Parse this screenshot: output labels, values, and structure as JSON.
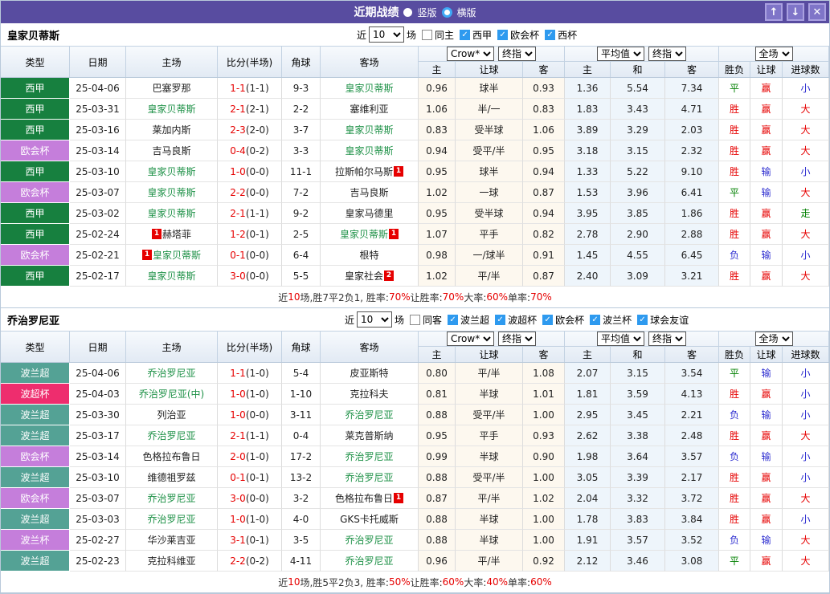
{
  "titlebar": {
    "title": "近期战绩",
    "vertical_label": "竖版",
    "horizontal_label": "横版",
    "bar_color": "#584CA0"
  },
  "window_buttons": {
    "up": "↑",
    "down": "↓",
    "close": "✕"
  },
  "filter": {
    "near_label": "近",
    "count": "10",
    "games_label": "场"
  },
  "headers": {
    "left": [
      "类型",
      "日期",
      "主场",
      "比分(半场)",
      "角球",
      "客场"
    ],
    "sub": [
      "主",
      "让球",
      "客",
      "主",
      "和",
      "客",
      "胜负",
      "让球",
      "进球数"
    ]
  },
  "dropdowns": {
    "odds_company": "Crow*",
    "final_odds": "终指",
    "average": "平均值",
    "final_odds2": "终指",
    "period": "全场"
  },
  "colors": {
    "focus_team": "#1E9147",
    "score": "#E60000",
    "type": {
      "西甲": "#17803F",
      "欧会杯": "#C57EDB",
      "波兰超": "#54A295",
      "波超杯": "#EE2D6E",
      "波兰杯": "#C57EDB"
    },
    "verdict": {
      "胜": "#E60000",
      "平": "#008000",
      "负": "#2A2ACF",
      "赢": "#E60000",
      "输": "#2A2ACF",
      "走": "#008000",
      "大": "#E60000",
      "小": "#2A2ACF"
    }
  },
  "tables": [
    {
      "team": "皇家贝蒂斯",
      "same_label": "同主",
      "leagues": [
        "西甲",
        "欧会杯",
        "西杯"
      ],
      "rows": [
        {
          "type": "西甲",
          "date": "25-04-06",
          "home": "巴塞罗那",
          "hf": false,
          "hb": "",
          "score": "1-1",
          "half": "(1-1)",
          "corner": "9-3",
          "away": "皇家贝蒂斯",
          "af": true,
          "ab": "",
          "ah": [
            "0.96",
            "球半",
            "0.93"
          ],
          "eu": [
            "1.36",
            "5.54",
            "7.34"
          ],
          "v": [
            "平",
            "赢",
            "小"
          ]
        },
        {
          "type": "西甲",
          "date": "25-03-31",
          "home": "皇家贝蒂斯",
          "hf": true,
          "hb": "",
          "score": "2-1",
          "half": "(2-1)",
          "corner": "2-2",
          "away": "塞维利亚",
          "af": false,
          "ab": "",
          "ah": [
            "1.06",
            "半/一",
            "0.83"
          ],
          "eu": [
            "1.83",
            "3.43",
            "4.71"
          ],
          "v": [
            "胜",
            "赢",
            "大"
          ]
        },
        {
          "type": "西甲",
          "date": "25-03-16",
          "home": "莱加内斯",
          "hf": false,
          "hb": "",
          "score": "2-3",
          "half": "(2-0)",
          "corner": "3-7",
          "away": "皇家贝蒂斯",
          "af": true,
          "ab": "",
          "ah": [
            "0.83",
            "受半球",
            "1.06"
          ],
          "eu": [
            "3.89",
            "3.29",
            "2.03"
          ],
          "v": [
            "胜",
            "赢",
            "大"
          ]
        },
        {
          "type": "欧会杯",
          "date": "25-03-14",
          "home": "吉马良斯",
          "hf": false,
          "hb": "",
          "score": "0-4",
          "half": "(0-2)",
          "corner": "3-3",
          "away": "皇家贝蒂斯",
          "af": true,
          "ab": "",
          "ah": [
            "0.94",
            "受平/半",
            "0.95"
          ],
          "eu": [
            "3.18",
            "3.15",
            "2.32"
          ],
          "v": [
            "胜",
            "赢",
            "大"
          ]
        },
        {
          "type": "西甲",
          "date": "25-03-10",
          "home": "皇家贝蒂斯",
          "hf": true,
          "hb": "",
          "score": "1-0",
          "half": "(0-0)",
          "corner": "11-1",
          "away": "拉斯帕尔马斯",
          "af": false,
          "ab": "1",
          "ah": [
            "0.95",
            "球半",
            "0.94"
          ],
          "eu": [
            "1.33",
            "5.22",
            "9.10"
          ],
          "v": [
            "胜",
            "输",
            "小"
          ]
        },
        {
          "type": "欧会杯",
          "date": "25-03-07",
          "home": "皇家贝蒂斯",
          "hf": true,
          "hb": "",
          "score": "2-2",
          "half": "(0-0)",
          "corner": "7-2",
          "away": "吉马良斯",
          "af": false,
          "ab": "",
          "ah": [
            "1.02",
            "一球",
            "0.87"
          ],
          "eu": [
            "1.53",
            "3.96",
            "6.41"
          ],
          "v": [
            "平",
            "输",
            "大"
          ]
        },
        {
          "type": "西甲",
          "date": "25-03-02",
          "home": "皇家贝蒂斯",
          "hf": true,
          "hb": "",
          "score": "2-1",
          "half": "(1-1)",
          "corner": "9-2",
          "away": "皇家马德里",
          "af": false,
          "ab": "",
          "ah": [
            "0.95",
            "受半球",
            "0.94"
          ],
          "eu": [
            "3.95",
            "3.85",
            "1.86"
          ],
          "v": [
            "胜",
            "赢",
            "走"
          ]
        },
        {
          "type": "西甲",
          "date": "25-02-24",
          "home": "赫塔菲",
          "hf": false,
          "hb": "1",
          "score": "1-2",
          "half": "(0-1)",
          "corner": "2-5",
          "away": "皇家贝蒂斯",
          "af": true,
          "ab": "1",
          "ah": [
            "1.07",
            "平手",
            "0.82"
          ],
          "eu": [
            "2.78",
            "2.90",
            "2.88"
          ],
          "v": [
            "胜",
            "赢",
            "大"
          ]
        },
        {
          "type": "欧会杯",
          "date": "25-02-21",
          "home": "皇家贝蒂斯",
          "hf": true,
          "hb": "1",
          "score": "0-1",
          "half": "(0-0)",
          "corner": "6-4",
          "away": "根特",
          "af": false,
          "ab": "",
          "ah": [
            "0.98",
            "一/球半",
            "0.91"
          ],
          "eu": [
            "1.45",
            "4.55",
            "6.45"
          ],
          "v": [
            "负",
            "输",
            "小"
          ]
        },
        {
          "type": "西甲",
          "date": "25-02-17",
          "home": "皇家贝蒂斯",
          "hf": true,
          "hb": "",
          "score": "3-0",
          "half": "(0-0)",
          "corner": "5-5",
          "away": "皇家社会",
          "af": false,
          "ab": "2",
          "ah": [
            "1.02",
            "平/半",
            "0.87"
          ],
          "eu": [
            "2.40",
            "3.09",
            "3.21"
          ],
          "v": [
            "胜",
            "赢",
            "大"
          ]
        }
      ],
      "summary": [
        {
          "t": "近",
          "c": "k"
        },
        {
          "t": "10",
          "c": "r"
        },
        {
          "t": "场,胜7平2负1, 胜率:",
          "c": "k"
        },
        {
          "t": "70%",
          "c": "r"
        },
        {
          "t": " 让胜率:",
          "c": "k"
        },
        {
          "t": "70%",
          "c": "r"
        },
        {
          "t": " 大率:",
          "c": "k"
        },
        {
          "t": "60%",
          "c": "r"
        },
        {
          "t": " 单率:",
          "c": "k"
        },
        {
          "t": "70%",
          "c": "r"
        }
      ]
    },
    {
      "team": "乔治罗尼亚",
      "same_label": "同客",
      "leagues": [
        "波兰超",
        "波超杯",
        "欧会杯",
        "波兰杯",
        "球会友谊"
      ],
      "rows": [
        {
          "type": "波兰超",
          "date": "25-04-06",
          "home": "乔治罗尼亚",
          "hf": true,
          "hb": "",
          "score": "1-1",
          "half": "(1-0)",
          "corner": "5-4",
          "away": "皮亚斯特",
          "af": false,
          "ab": "",
          "ah": [
            "0.80",
            "平/半",
            "1.08"
          ],
          "eu": [
            "2.07",
            "3.15",
            "3.54"
          ],
          "v": [
            "平",
            "输",
            "小"
          ]
        },
        {
          "type": "波超杯",
          "date": "25-04-03",
          "home": "乔治罗尼亚(中)",
          "hf": true,
          "hb": "",
          "score": "1-0",
          "half": "(1-0)",
          "corner": "1-10",
          "away": "克拉科夫",
          "af": false,
          "ab": "",
          "ah": [
            "0.81",
            "半球",
            "1.01"
          ],
          "eu": [
            "1.81",
            "3.59",
            "4.13"
          ],
          "v": [
            "胜",
            "赢",
            "小"
          ]
        },
        {
          "type": "波兰超",
          "date": "25-03-30",
          "home": "列治亚",
          "hf": false,
          "hb": "",
          "score": "1-0",
          "half": "(0-0)",
          "corner": "3-11",
          "away": "乔治罗尼亚",
          "af": true,
          "ab": "",
          "ah": [
            "0.88",
            "受平/半",
            "1.00"
          ],
          "eu": [
            "2.95",
            "3.45",
            "2.21"
          ],
          "v": [
            "负",
            "输",
            "小"
          ]
        },
        {
          "type": "波兰超",
          "date": "25-03-17",
          "home": "乔治罗尼亚",
          "hf": true,
          "hb": "",
          "score": "2-1",
          "half": "(1-1)",
          "corner": "0-4",
          "away": "莱克普斯纳",
          "af": false,
          "ab": "",
          "ah": [
            "0.95",
            "平手",
            "0.93"
          ],
          "eu": [
            "2.62",
            "3.38",
            "2.48"
          ],
          "v": [
            "胜",
            "赢",
            "大"
          ]
        },
        {
          "type": "欧会杯",
          "date": "25-03-14",
          "home": "色格拉布鲁日",
          "hf": false,
          "hb": "",
          "score": "2-0",
          "half": "(1-0)",
          "corner": "17-2",
          "away": "乔治罗尼亚",
          "af": true,
          "ab": "",
          "ah": [
            "0.99",
            "半球",
            "0.90"
          ],
          "eu": [
            "1.98",
            "3.64",
            "3.57"
          ],
          "v": [
            "负",
            "输",
            "小"
          ]
        },
        {
          "type": "波兰超",
          "date": "25-03-10",
          "home": "维德祖罗兹",
          "hf": false,
          "hb": "",
          "score": "0-1",
          "half": "(0-1)",
          "corner": "13-2",
          "away": "乔治罗尼亚",
          "af": true,
          "ab": "",
          "ah": [
            "0.88",
            "受平/半",
            "1.00"
          ],
          "eu": [
            "3.05",
            "3.39",
            "2.17"
          ],
          "v": [
            "胜",
            "赢",
            "小"
          ]
        },
        {
          "type": "欧会杯",
          "date": "25-03-07",
          "home": "乔治罗尼亚",
          "hf": true,
          "hb": "",
          "score": "3-0",
          "half": "(0-0)",
          "corner": "3-2",
          "away": "色格拉布鲁日",
          "af": false,
          "ab": "1",
          "ah": [
            "0.87",
            "平/半",
            "1.02"
          ],
          "eu": [
            "2.04",
            "3.32",
            "3.72"
          ],
          "v": [
            "胜",
            "赢",
            "大"
          ]
        },
        {
          "type": "波兰超",
          "date": "25-03-03",
          "home": "乔治罗尼亚",
          "hf": true,
          "hb": "",
          "score": "1-0",
          "half": "(1-0)",
          "corner": "4-0",
          "away": "GKS卡托威斯",
          "af": false,
          "ab": "",
          "ah": [
            "0.88",
            "半球",
            "1.00"
          ],
          "eu": [
            "1.78",
            "3.83",
            "3.84"
          ],
          "v": [
            "胜",
            "赢",
            "小"
          ]
        },
        {
          "type": "波兰杯",
          "date": "25-02-27",
          "home": "华沙莱吉亚",
          "hf": false,
          "hb": "",
          "score": "3-1",
          "half": "(0-1)",
          "corner": "3-5",
          "away": "乔治罗尼亚",
          "af": true,
          "ab": "",
          "ah": [
            "0.88",
            "半球",
            "1.00"
          ],
          "eu": [
            "1.91",
            "3.57",
            "3.52"
          ],
          "v": [
            "负",
            "输",
            "大"
          ]
        },
        {
          "type": "波兰超",
          "date": "25-02-23",
          "home": "克拉科维亚",
          "hf": false,
          "hb": "",
          "score": "2-2",
          "half": "(0-2)",
          "corner": "4-11",
          "away": "乔治罗尼亚",
          "af": true,
          "ab": "",
          "ah": [
            "0.96",
            "平/半",
            "0.92"
          ],
          "eu": [
            "2.12",
            "3.46",
            "3.08"
          ],
          "v": [
            "平",
            "赢",
            "大"
          ]
        }
      ],
      "summary": [
        {
          "t": "近",
          "c": "k"
        },
        {
          "t": "10",
          "c": "r"
        },
        {
          "t": "场,胜5平2负3, 胜率:",
          "c": "k"
        },
        {
          "t": "50%",
          "c": "r"
        },
        {
          "t": " 让胜率:",
          "c": "k"
        },
        {
          "t": "60%",
          "c": "r"
        },
        {
          "t": " 大率:",
          "c": "k"
        },
        {
          "t": "40%",
          "c": "r"
        },
        {
          "t": " 单率:",
          "c": "k"
        },
        {
          "t": "60%",
          "c": "r"
        }
      ]
    }
  ]
}
